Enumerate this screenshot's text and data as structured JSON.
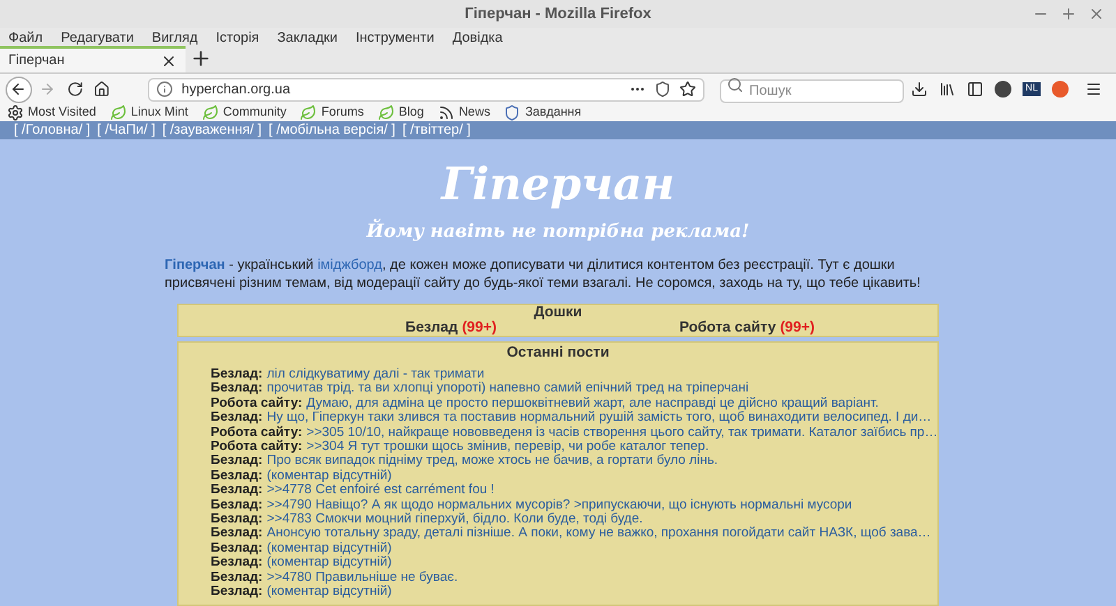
{
  "window": {
    "title": "Гіперчан - Mozilla Firefox"
  },
  "menu": [
    "Файл",
    "Редагувати",
    "Вигляд",
    "Історія",
    "Закладки",
    "Інструменти",
    "Довідка"
  ],
  "tabs": [
    {
      "label": "Гіперчан",
      "selected": true
    }
  ],
  "address_bar": {
    "value": "hyperchan.org.ua"
  },
  "search": {
    "placeholder": "Пошук"
  },
  "extension_badge": "NL",
  "bookmarks": [
    {
      "kind": "gear",
      "label": "Most Visited"
    },
    {
      "kind": "leaf",
      "label": "Linux Mint"
    },
    {
      "kind": "leaf",
      "label": "Community"
    },
    {
      "kind": "leaf",
      "label": "Forums"
    },
    {
      "kind": "leaf",
      "label": "Blog"
    },
    {
      "kind": "rss",
      "label": "News"
    },
    {
      "kind": "shield",
      "label": "Завдання"
    }
  ],
  "site_nav": [
    "[ /Головна/ ]",
    "[ /ЧаПи/ ]",
    "[ /зауваження/ ]",
    "[ /мобільна версія/ ]",
    "[ /твіттер/ ]"
  ],
  "logo": "Гіперчан",
  "slogan": "Йому навіть не потрібна реклама!",
  "intro_parts": [
    {
      "kind": "link",
      "text": "Гіперчан"
    },
    {
      "kind": "text",
      "text": " - український "
    },
    {
      "kind": "link",
      "text": "іміджборд"
    },
    {
      "kind": "text",
      "text": ", де кожен може дописувати чи ділитися контентом без реєстрації. Тут є дошки присвячені різним темам, від модерації сайту до будь-якої теми взагалі. Не соромся, заходь на ту, що тебе цікавить!"
    }
  ],
  "boards": {
    "title": "Дошки",
    "items": [
      {
        "name": "Безлад",
        "count": "(99+)"
      },
      {
        "name": "Робота сайту",
        "count": "(99+)"
      }
    ]
  },
  "recent_posts": {
    "title": "Останні пости",
    "items": [
      {
        "board": "Безлад:",
        "text": "ліл слідкуватиму далі - так тримати"
      },
      {
        "board": "Безлад:",
        "text": "прочитав трід. та ви хлопці упороті) напевно самий епічний тред на тріперчані"
      },
      {
        "board": "Робота сайту:",
        "text": "Думаю, для адміна це просто першоквітневий жарт, але насправді це дійсно кращий варіант."
      },
      {
        "board": "Безлад:",
        "text": "Ну що, Гіперкун таки злився та поставив нормальний рушій замість того, щоб винаходити велосипед. І ди…"
      },
      {
        "board": "Робота сайту:",
        "text": ">>305 10/10, найкраще нововведеня із часів створення цього сайту, так тримати. Каталог заїбись пр…"
      },
      {
        "board": "Робота сайту:",
        "text": ">>304 Я тут трошки щось змінив, перевір, чи робе каталог тепер."
      },
      {
        "board": "Безлад:",
        "text": "Про всяк випадок підніму тред, може хтось не бачив, а гортати було лінь."
      },
      {
        "board": "Безлад:",
        "text": "(коментар відсутній)"
      },
      {
        "board": "Безлад:",
        "text": ">>4778 Cet enfoiré est carrément fou !"
      },
      {
        "board": "Безлад:",
        "text": ">>4790 Навіщо? А як щодо нормальних мусорів? >припускаючи, що існують нормальні мусори"
      },
      {
        "board": "Безлад:",
        "text": ">>4783 Смокчи моцний гіперхуй, бідло. Коли буде, тоді буде."
      },
      {
        "board": "Безлад:",
        "text": "Анонсую тотальну зраду, деталі пізніше. А поки, кому не важко, прохання погойдати сайт НАЗК, щоб зава…"
      },
      {
        "board": "Безлад:",
        "text": "(коментар відсутній)"
      },
      {
        "board": "Безлад:",
        "text": "(коментар відсутній)"
      },
      {
        "board": "Безлад:",
        "text": ">>4780 Правильніше не буває."
      },
      {
        "board": "Безлад:",
        "text": "(коментар відсутній)"
      }
    ]
  }
}
